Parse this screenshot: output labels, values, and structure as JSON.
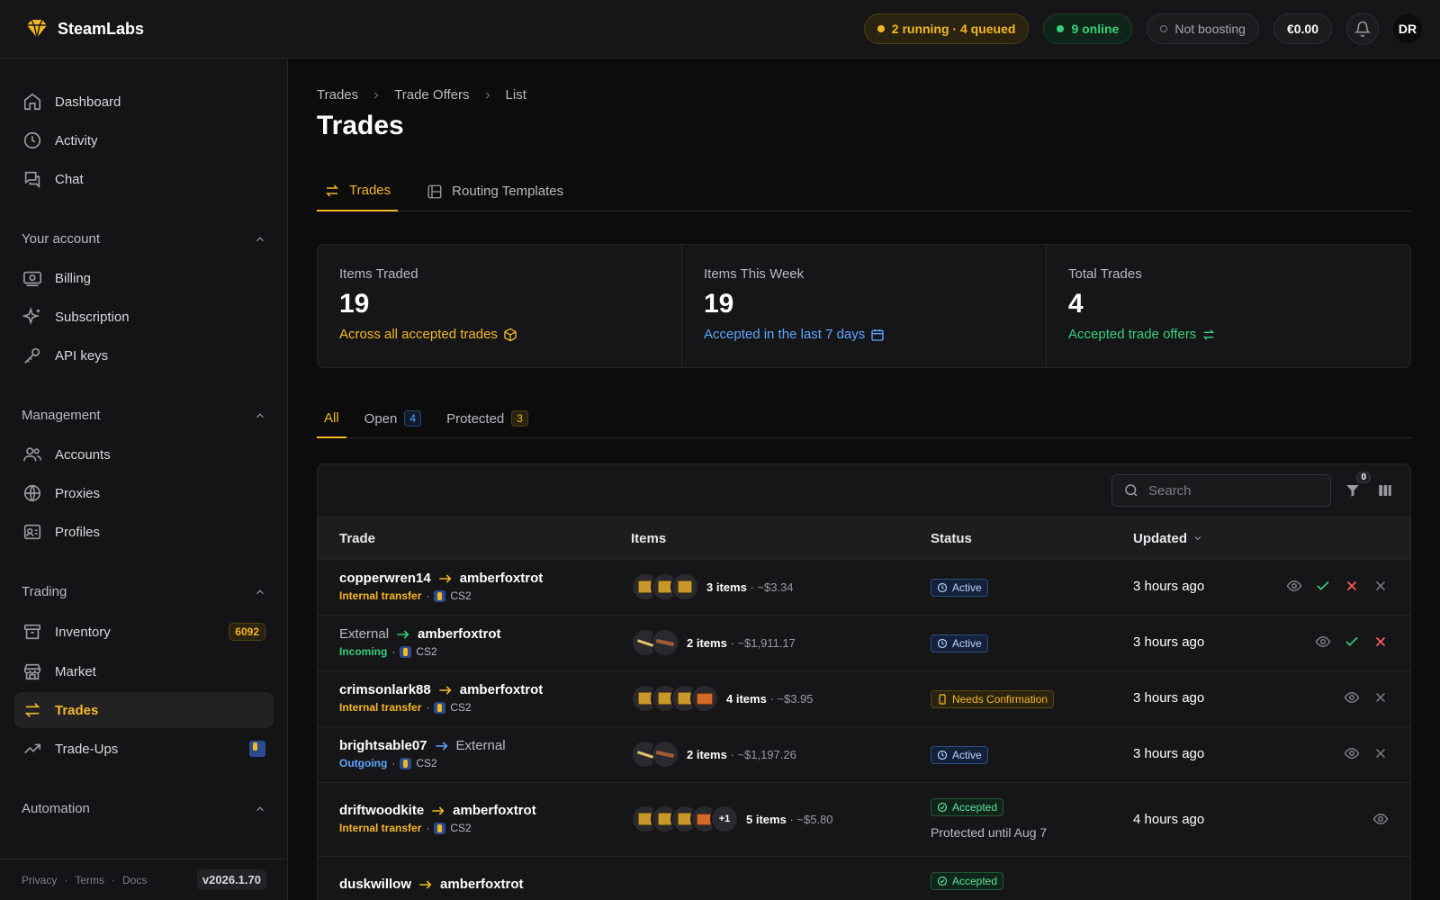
{
  "app": {
    "name": "SteamLabs"
  },
  "topbar": {
    "tasks": "2 running · 4 queued",
    "online": "9 online",
    "boost": "Not boosting",
    "balance": "€0.00",
    "avatar_initials": "DR"
  },
  "sidebar": {
    "top_items": [
      {
        "label": "Dashboard",
        "icon": "home-icon"
      },
      {
        "label": "Activity",
        "icon": "clock-icon"
      },
      {
        "label": "Chat",
        "icon": "chat-icon"
      }
    ],
    "sections": [
      {
        "title": "Your account",
        "items": [
          {
            "label": "Billing",
            "icon": "billing-icon"
          },
          {
            "label": "Subscription",
            "icon": "sparkles-icon"
          },
          {
            "label": "API keys",
            "icon": "key-icon"
          }
        ]
      },
      {
        "title": "Management",
        "items": [
          {
            "label": "Accounts",
            "icon": "users-icon"
          },
          {
            "label": "Proxies",
            "icon": "globe-icon"
          },
          {
            "label": "Profiles",
            "icon": "profile-card-icon"
          }
        ]
      },
      {
        "title": "Trading",
        "items": [
          {
            "label": "Inventory",
            "icon": "archive-icon",
            "badge": "6092"
          },
          {
            "label": "Market",
            "icon": "store-icon"
          },
          {
            "label": "Trades",
            "icon": "swap-icon",
            "active": true
          },
          {
            "label": "Trade-Ups",
            "icon": "trending-up-icon"
          }
        ]
      },
      {
        "title": "Automation",
        "items": []
      }
    ],
    "footer": {
      "privacy": "Privacy",
      "terms": "Terms",
      "docs": "Docs",
      "version": "v2026.1.70"
    }
  },
  "main": {
    "breadcrumb": [
      "Trades",
      "Trade Offers",
      "List"
    ],
    "title": "Trades",
    "tabs": [
      {
        "label": "Trades",
        "active": true
      },
      {
        "label": "Routing Templates"
      }
    ],
    "stats": [
      {
        "label": "Items Traded",
        "value": "19",
        "sub": "Across all accepted trades",
        "color": "#f5b820"
      },
      {
        "label": "Items This Week",
        "value": "19",
        "sub": "Accepted in the last 7 days",
        "color": "#5aa7ff"
      },
      {
        "label": "Total Trades",
        "value": "4",
        "sub": "Accepted trade offers",
        "color": "#33d17a"
      }
    ],
    "filter_tabs": [
      {
        "label": "All",
        "active": true
      },
      {
        "label": "Open",
        "count": "4"
      },
      {
        "label": "Protected",
        "count": "3"
      }
    ],
    "search_placeholder": "Search",
    "filter_count": "0",
    "columns": {
      "trade": "Trade",
      "items": "Items",
      "status": "Status",
      "updated": "Updated"
    },
    "rows": [
      {
        "from": "copperwren14",
        "to": "amberfoxtrot",
        "type": "Internal transfer",
        "game": "CS2",
        "count": "3 items",
        "value": "~$3.34",
        "status": "Active",
        "updated": "3 hours ago"
      },
      {
        "from": "External",
        "to": "amberfoxtrot",
        "type": "Incoming",
        "game": "CS2",
        "count": "2 items",
        "value": "~$1,911.17",
        "status": "Active",
        "updated": "3 hours ago"
      },
      {
        "from": "crimsonlark88",
        "to": "amberfoxtrot",
        "type": "Internal transfer",
        "game": "CS2",
        "count": "4 items",
        "value": "~$3.95",
        "status": "Needs Confirmation",
        "updated": "3 hours ago"
      },
      {
        "from": "brightsable07",
        "to": "External",
        "type": "Outgoing",
        "game": "CS2",
        "count": "2 items",
        "value": "~$1,197.26",
        "status": "Active",
        "updated": "3 hours ago"
      },
      {
        "from": "driftwoodkite",
        "to": "amberfoxtrot",
        "type": "Internal transfer",
        "game": "CS2",
        "count": "5 items",
        "value": "~$5.80",
        "more": "+1",
        "status": "Accepted",
        "protected": "Protected until Aug 7",
        "updated": "4 hours ago"
      },
      {
        "from": "duskwillow",
        "to": "amberfoxtrot",
        "status": "Accepted"
      }
    ]
  }
}
